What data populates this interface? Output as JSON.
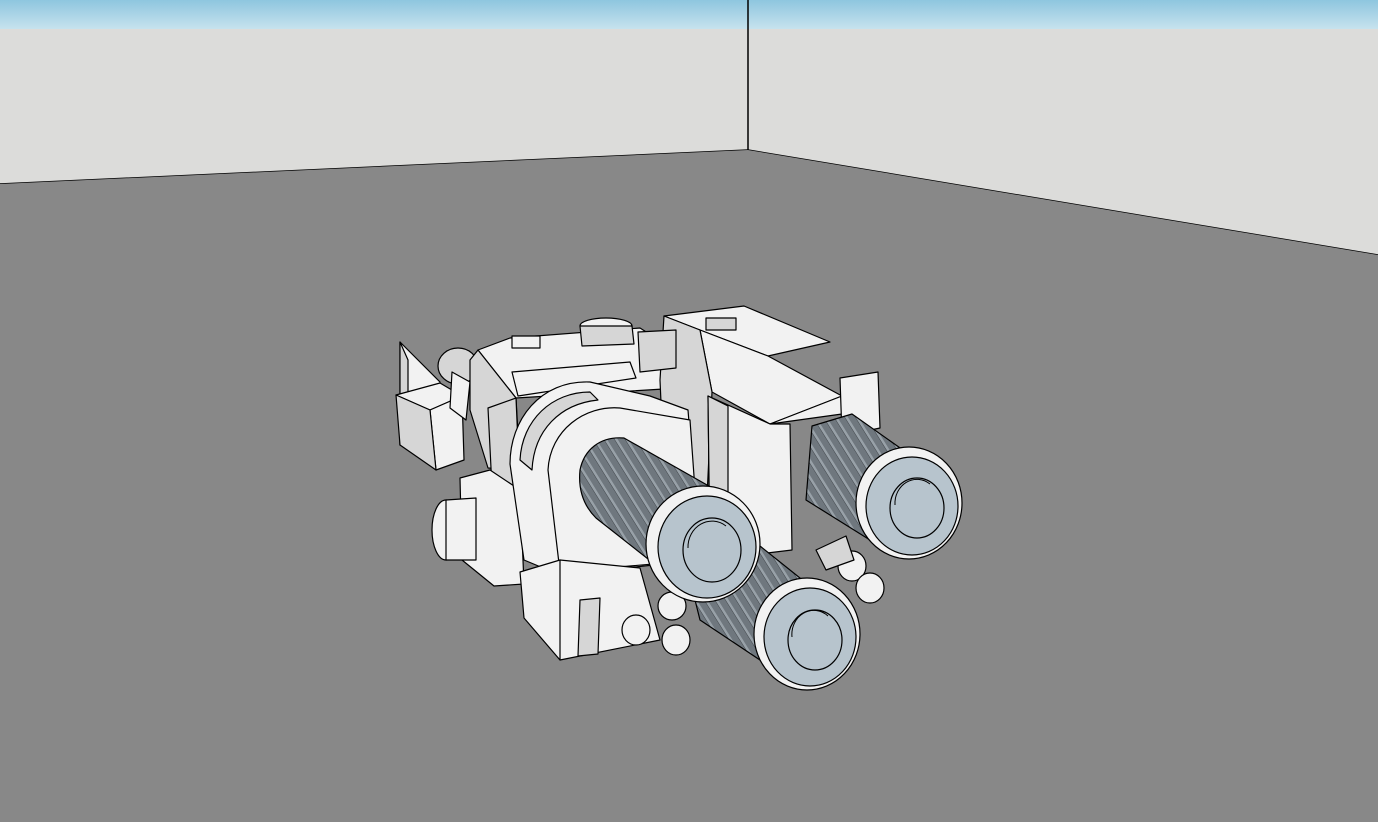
{
  "viewport": {
    "colors": {
      "sky_top": "#8ec6df",
      "sky_bottom": "#c9e3ee",
      "wall": "#dcdcda",
      "ground": "#888888",
      "edge": "#000000",
      "model_light": "#f2f2f2",
      "model_mid": "#d6d6d6",
      "model_dark": "#bdbdbd",
      "barrel_dark": "#5f676e",
      "barrel_light": "#8f989f",
      "muzzle": "#b7c4cd"
    }
  }
}
